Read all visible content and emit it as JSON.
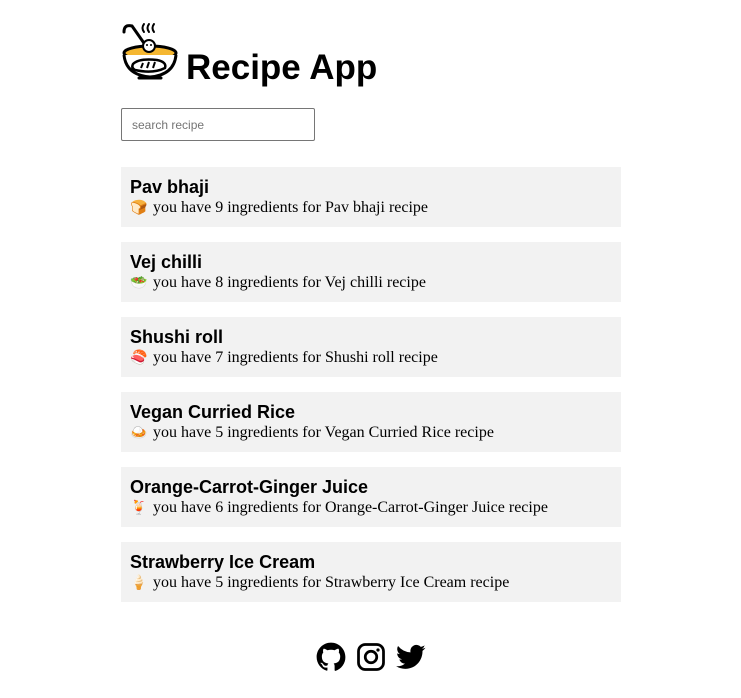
{
  "app": {
    "title": "Recipe App",
    "logo_icon": "cooking-pot-icon"
  },
  "search": {
    "placeholder": "search recipe",
    "value": ""
  },
  "recipes": [
    {
      "name": "Pav bhaji",
      "emoji": "🍞",
      "description": "you have 9 ingredients for Pav bhaji recipe"
    },
    {
      "name": "Vej chilli",
      "emoji": "🥗",
      "description": "you have 8 ingredients for Vej chilli recipe"
    },
    {
      "name": "Shushi roll",
      "emoji": "🍣",
      "description": "you have 7 ingredients for Shushi roll recipe"
    },
    {
      "name": "Vegan Curried Rice",
      "emoji": "🍛",
      "description": "you have 5 ingredients for Vegan Curried Rice recipe"
    },
    {
      "name": "Orange-Carrot-Ginger Juice",
      "emoji": "🍹",
      "description": "you have 6 ingredients for Orange-Carrot-Ginger Juice recipe"
    },
    {
      "name": "Strawberry Ice Cream",
      "emoji": "🍦",
      "description": "you have 5 ingredients for Strawberry Ice Cream recipe"
    }
  ],
  "footer": {
    "links": [
      "github-icon",
      "instagram-icon",
      "twitter-icon"
    ]
  },
  "colors": {
    "card_background": "#f2f2f2",
    "logo_accent": "#f5b731",
    "text": "#000000"
  }
}
